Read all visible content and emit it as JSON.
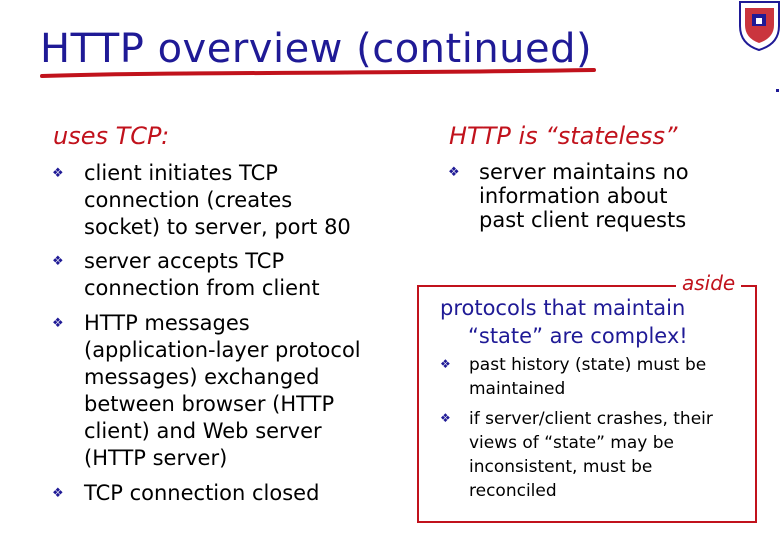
{
  "slide": {
    "title": "HTTP overview (continued)",
    "left": {
      "heading": "uses TCP:",
      "bullets": [
        {
          "lines": [
            "client initiates TCP",
            "connection (creates",
            "socket) to server,  port 80"
          ]
        },
        {
          "lines": [
            "server accepts TCP",
            "connection from client"
          ]
        },
        {
          "lines": [
            "HTTP messages",
            "(application-layer protocol",
            "messages) exchanged",
            "between browser (HTTP",
            "client) and Web server",
            "(HTTP server)"
          ]
        },
        {
          "lines": [
            "TCP connection closed"
          ]
        }
      ]
    },
    "right": {
      "heading": "HTTP is “stateless”",
      "bullets": [
        {
          "lines": [
            "server maintains no",
            "information about",
            "past client requests"
          ]
        }
      ]
    },
    "aside": {
      "label": "aside",
      "title_line1": "protocols that maintain",
      "title_line2": "“state” are complex!",
      "bullets": [
        {
          "lines": [
            "past history (state) must be",
            "maintained"
          ]
        },
        {
          "lines": [
            "if server/client crashes, their",
            "views of “state” may be",
            "inconsistent, must be",
            "reconciled"
          ]
        }
      ]
    },
    "colors": {
      "title": "#1f1a96",
      "accent_red": "#c1121c",
      "bullet": "#1f1a96"
    },
    "icons": {
      "bullet": "diamond-bullet-icon",
      "logo": "university-seal-icon"
    }
  }
}
